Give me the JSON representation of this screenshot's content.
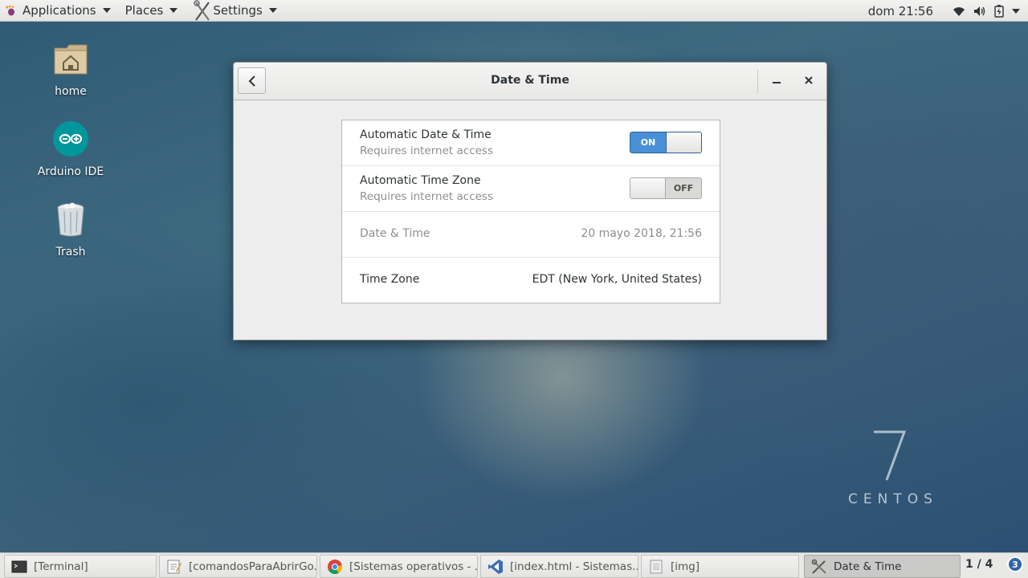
{
  "topbar": {
    "applications_label": "Applications",
    "places_label": "Places",
    "settings_label": "Settings",
    "clock": "dom 21:56"
  },
  "desktop": {
    "icons": [
      {
        "label": "home"
      },
      {
        "label": "Arduino IDE"
      },
      {
        "label": "Trash"
      }
    ],
    "watermark_number": "7",
    "watermark_word": "CENTOS"
  },
  "window": {
    "title": "Date & Time",
    "rows": [
      {
        "title": "Automatic Date & Time",
        "subtitle": "Requires internet access",
        "switch_label": "ON",
        "switch_state": "on"
      },
      {
        "title": "Automatic Time Zone",
        "subtitle": "Requires internet access",
        "switch_label": "OFF",
        "switch_state": "off"
      },
      {
        "label": "Date & Time",
        "value": "20 mayo 2018, 21:56"
      },
      {
        "label": "Time Zone",
        "value": "EDT (New York, United States)"
      }
    ]
  },
  "taskbar": {
    "tasks": [
      {
        "label": "[Terminal]",
        "icon": "terminal-icon"
      },
      {
        "label": "[comandosParaAbrirGo...",
        "icon": "text-editor-icon"
      },
      {
        "label": "[Sistemas operativos - ...",
        "icon": "chrome-icon"
      },
      {
        "label": "[index.html - Sistemas...",
        "icon": "vscode-icon"
      },
      {
        "label": "[img]",
        "icon": "file-icon"
      },
      {
        "label": "Date & Time",
        "icon": "settings-icon",
        "active": true
      }
    ],
    "pager": "1 / 4",
    "notification_count": "3"
  },
  "colors": {
    "accent_blue": "#4a90d9",
    "badge_blue": "#3465a4"
  }
}
